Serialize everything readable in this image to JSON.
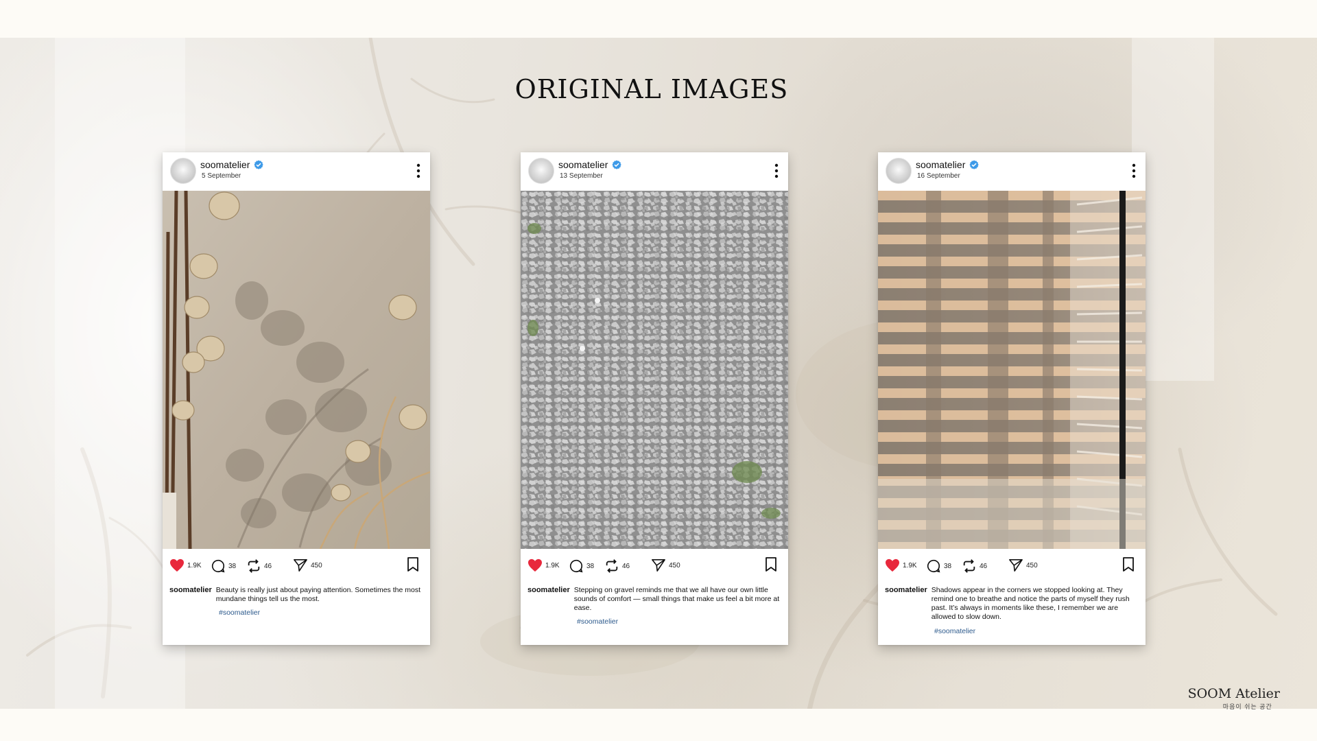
{
  "slide": {
    "title": "ORIGINAL IMAGES"
  },
  "brand": {
    "name": "SOOM Atelier",
    "tagline": "마음이 쉬는 공간"
  },
  "icons": {
    "verified": "verified-badge-icon",
    "menu": "more-vertical-icon",
    "like": "heart-icon",
    "comment": "comment-icon",
    "repost": "repost-icon",
    "share": "send-icon",
    "save": "bookmark-icon"
  },
  "colors": {
    "like": "#e8283c",
    "verified": "#3d9ae8",
    "hashtag": "#2d5a8c"
  },
  "posts": [
    {
      "username": "soomatelier",
      "date": "5 September",
      "likes": "1.9K",
      "comments": "38",
      "reposts": "46",
      "shares": "450",
      "caption_user": "soomatelier",
      "caption": "Beauty is really just about paying attention. Sometimes the most mundane things tell us the most.",
      "hashtag": "#soomatelier"
    },
    {
      "username": "soomatelier",
      "date": "13 September",
      "likes": "1.9K",
      "comments": "38",
      "reposts": "46",
      "shares": "450",
      "caption_user": "soomatelier",
      "caption": "Stepping on gravel reminds me that we all have our own little sounds of comfort — small things that make us feel a bit more at ease.",
      "hashtag": "#soomatelier"
    },
    {
      "username": "soomatelier",
      "date": "16 September",
      "likes": "1.9K",
      "comments": "38",
      "reposts": "46",
      "shares": "450",
      "caption_user": "soomatelier",
      "caption": "Shadows appear in the corners we stopped looking at. They remind one to breathe and notice the parts of myself they rush past. It’s always in moments like these, I remember we are allowed to slow down.",
      "hashtag": "#soomatelier"
    }
  ]
}
